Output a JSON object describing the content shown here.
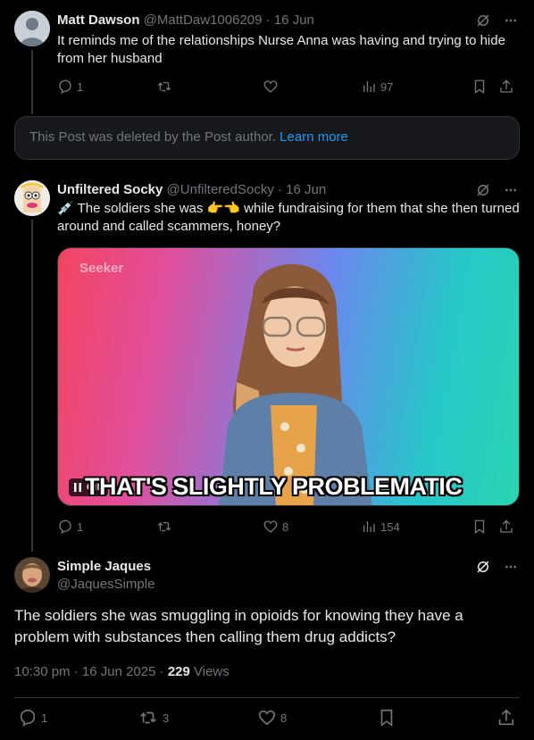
{
  "posts": [
    {
      "name": "Matt Dawson",
      "handle": "@MattDaw1006209",
      "sep": "·",
      "date": "16 Jun",
      "text": "It reminds me of the relationships Nurse Anna was having and trying to hide from her husband",
      "replies": "1",
      "views": "97"
    },
    {
      "name": "Unfiltered Socky",
      "handle": "@UnfilteredSocky",
      "sep": "·",
      "date": "16 Jun",
      "text_emoji": "💉",
      "text_part1": " The soldiers she was ",
      "text_emoji2": "👉👈",
      "text_part2": " while fundraising for them that she then turned around and called scammers, honey?",
      "media_logo": "Seeker",
      "media_caption": "THAT'S SLIGHTLY PROBLEMATIC",
      "gif_label": "GIF",
      "replies": "1",
      "likes": "8",
      "views": "154"
    }
  ],
  "deleted_notice": {
    "text": "This Post was deleted by the Post author.",
    "link": "Learn more"
  },
  "main_post": {
    "name": "Simple Jaques",
    "handle": "@JaquesSimple",
    "text": "The soldiers she was smuggling in opioids for knowing they have a problem with substances then calling them drug addicts?",
    "time": "10:30 pm",
    "sep": "·",
    "date": "16 Jun 2025",
    "sep2": "·",
    "view_count": "229",
    "views_label": "Views",
    "replies": "1",
    "reposts": "3",
    "likes": "8"
  },
  "colors": {
    "background": "#000000",
    "text": "#e7e9ea",
    "muted": "#71767b",
    "link": "#1d9bf0",
    "border": "#2f3336"
  },
  "icons": [
    "grok-icon",
    "more-icon",
    "reply-icon",
    "repost-icon",
    "like-icon",
    "views-icon",
    "bookmark-icon",
    "share-icon"
  ]
}
